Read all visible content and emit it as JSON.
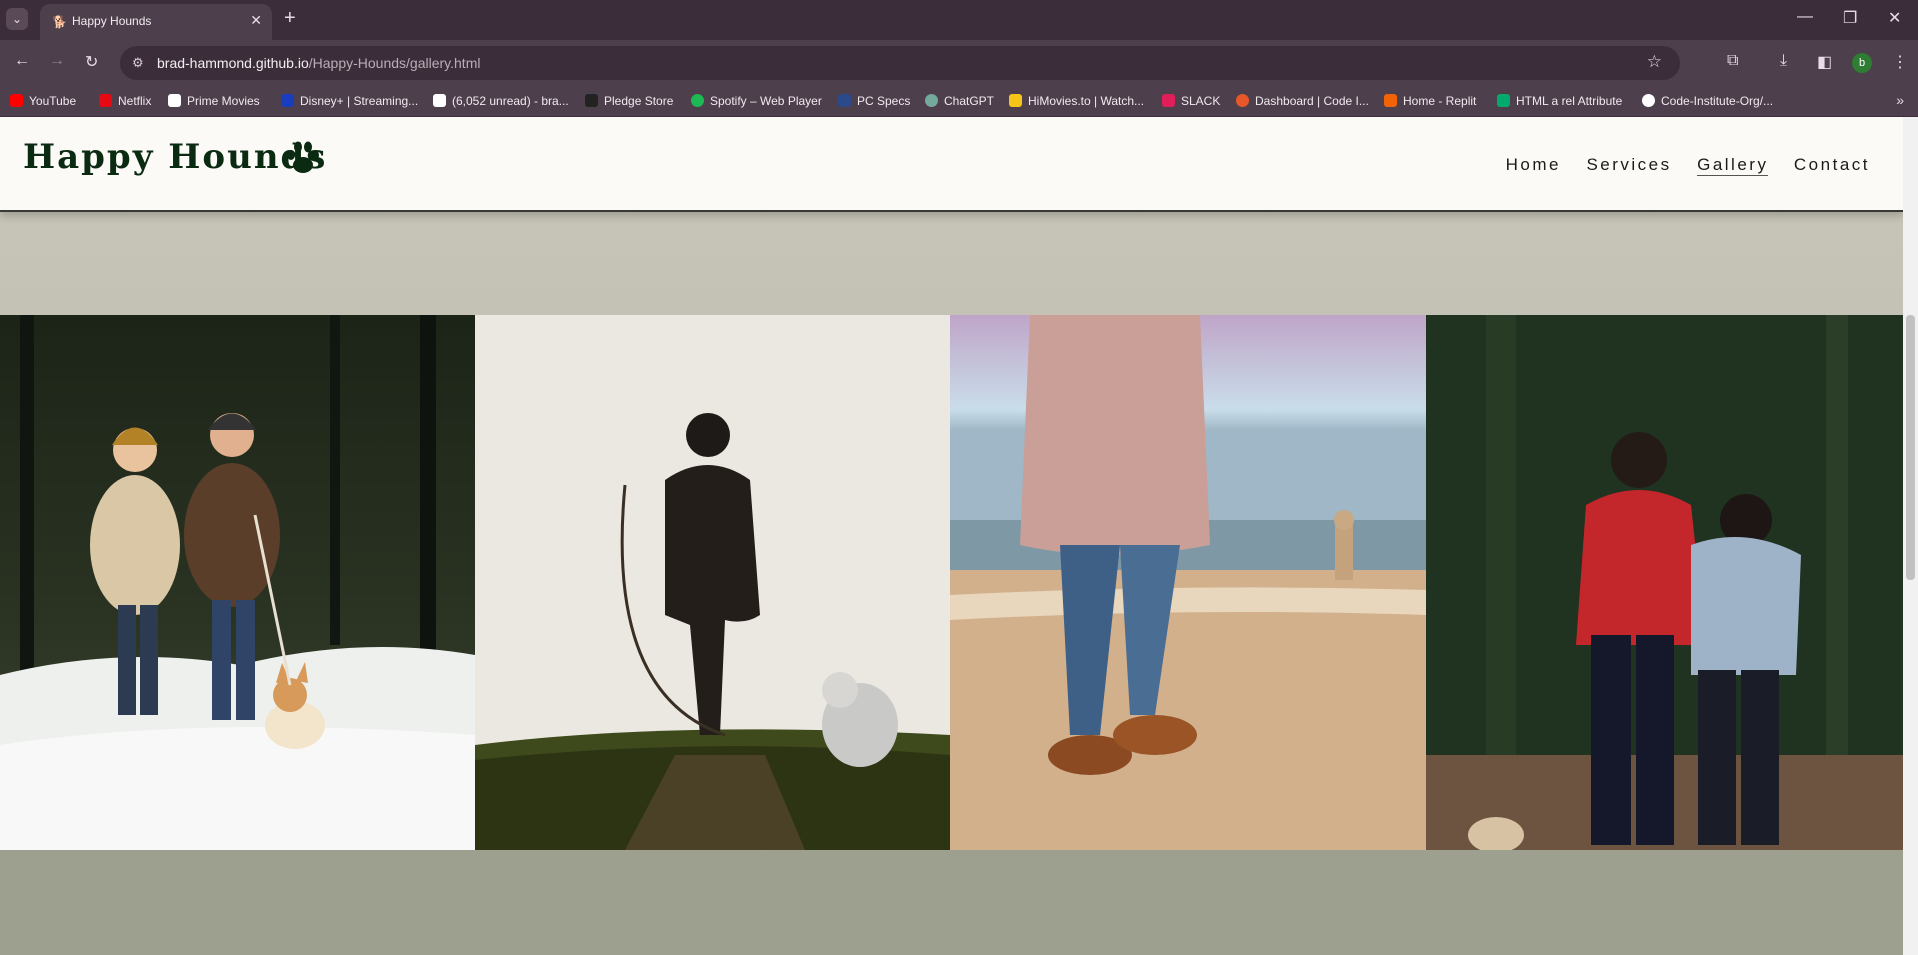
{
  "browser": {
    "tab_title": "Happy Hounds",
    "url_host": "brad-hammond.github.io",
    "url_path": "/Happy-Hounds/gallery.html",
    "profile_initial": "b",
    "bookmarks": [
      {
        "label": "YouTube",
        "color": "#ff0000"
      },
      {
        "label": "Netflix",
        "color": "#e50914"
      },
      {
        "label": "Prime Movies",
        "color": "#ffffff"
      },
      {
        "label": "Disney+ | Streaming...",
        "color": "#1a3dbf"
      },
      {
        "label": "(6,052 unread) - bra...",
        "color": "#ffffff"
      },
      {
        "label": "Pledge Store",
        "color": "#222222"
      },
      {
        "label": "Spotify – Web Player",
        "color": "#1db954"
      },
      {
        "label": "PC Specs",
        "color": "#2b4a8a"
      },
      {
        "label": "ChatGPT",
        "color": "#74aa9c"
      },
      {
        "label": "HiMovies.to | Watch...",
        "color": "#f5c518"
      },
      {
        "label": "SLACK",
        "color": "#e01e5a"
      },
      {
        "label": "Dashboard | Code I...",
        "color": "#e8572a"
      },
      {
        "label": "Home - Replit",
        "color": "#f26207"
      },
      {
        "label": "HTML a rel Attribute",
        "color": "#04aa6d"
      },
      {
        "label": "Code-Institute-Org/...",
        "color": "#ffffff"
      }
    ]
  },
  "site": {
    "logo": "Happy Hounds",
    "nav": [
      "Home",
      "Services",
      "Gallery",
      "Contact"
    ],
    "active_nav": "Gallery"
  },
  "colors": {
    "brand_green": "#0b2a12",
    "header_bg": "#fbfaf6",
    "page_bg": "#c8c6b8"
  }
}
